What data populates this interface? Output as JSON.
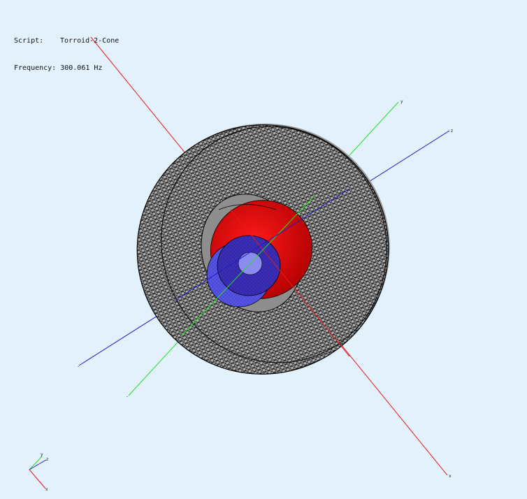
{
  "info": {
    "script_label": "Script:",
    "script_value": "Torroid-2-Cone",
    "frequency_label": "Frequency:",
    "frequency_value": "300.061 Hz"
  },
  "axes": {
    "x": {
      "label": "x",
      "color": "#e81a1a"
    },
    "y": {
      "label": "y",
      "color": "#22e022"
    },
    "z": {
      "label": "z",
      "color": "#1d1dc8"
    }
  },
  "triad": {
    "x_label": "x",
    "y_label": "y",
    "z_label": "z"
  },
  "model": {
    "torus_color": "#b3b3b3",
    "mesh_color": "#000000",
    "cone_color": "#d80000",
    "inner_cone_color": "#5050e6"
  }
}
